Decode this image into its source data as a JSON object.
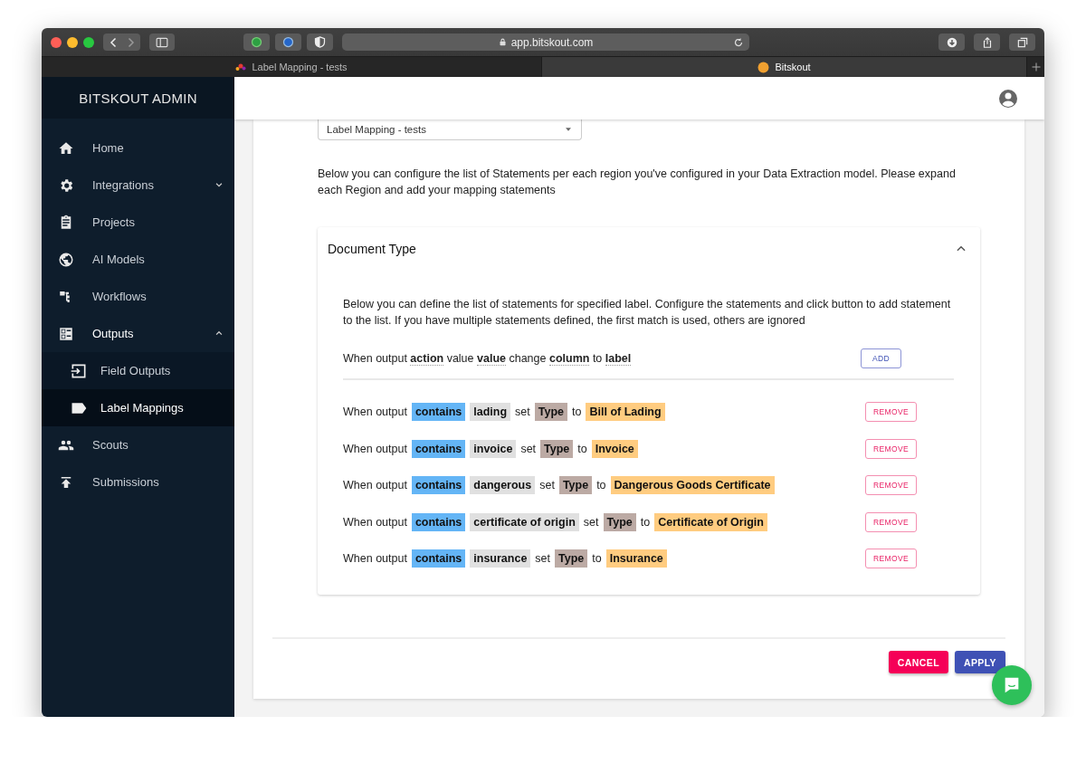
{
  "browser": {
    "address": "app.bitskout.com",
    "tabs": [
      {
        "title": "Label Mapping - tests",
        "selected": false
      },
      {
        "title": "Bitskout",
        "selected": true
      }
    ]
  },
  "sidebar": {
    "title": "BITSKOUT ADMIN",
    "items": [
      {
        "label": "Home",
        "selected": false
      },
      {
        "label": "Integrations",
        "selected": false,
        "expanded": false
      },
      {
        "label": "Projects",
        "selected": false
      },
      {
        "label": "AI Models",
        "selected": false
      },
      {
        "label": "Workflows",
        "selected": false
      },
      {
        "label": "Outputs",
        "selected": false,
        "expanded": true,
        "children": [
          {
            "label": "Field Outputs",
            "selected": false
          },
          {
            "label": "Label Mappings",
            "selected": true
          }
        ]
      },
      {
        "label": "Scouts",
        "selected": false
      },
      {
        "label": "Submissions",
        "selected": false
      }
    ]
  },
  "content": {
    "dropdown": {
      "value": "Label Mapping - tests"
    },
    "intro": "Below you can configure the list of Statements per each region you've configured in your Data Extraction model. Please expand each Region and add your mapping statements",
    "panel": {
      "title": "Document Type",
      "expanded": true,
      "description": "Below you can define the list of statements for specified label. Configure the statements and click button to add statement to the list. If you have multiple statements defined, the first match is used, others are ignored",
      "builder": {
        "sentence": "When output **action** value **value** change **column** to **label**",
        "button": "ADD"
      },
      "statements": [
        {
          "button": "REMOVE",
          "tokens": [
            {
              "kind": "text",
              "text": "When output"
            },
            {
              "kind": "action",
              "text": "contains"
            },
            {
              "kind": "value",
              "text": "lading"
            },
            {
              "kind": "text",
              "text": "set"
            },
            {
              "kind": "column",
              "text": "Type"
            },
            {
              "kind": "text",
              "text": "to"
            },
            {
              "kind": "label",
              "text": "Bill of Lading"
            }
          ]
        },
        {
          "button": "REMOVE",
          "tokens": [
            {
              "kind": "text",
              "text": "When output"
            },
            {
              "kind": "action",
              "text": "contains"
            },
            {
              "kind": "value",
              "text": "invoice"
            },
            {
              "kind": "text",
              "text": "set"
            },
            {
              "kind": "column",
              "text": "Type"
            },
            {
              "kind": "text",
              "text": "to"
            },
            {
              "kind": "label",
              "text": "Invoice"
            }
          ]
        },
        {
          "button": "REMOVE",
          "tokens": [
            {
              "kind": "text",
              "text": "When output"
            },
            {
              "kind": "action",
              "text": "contains"
            },
            {
              "kind": "value",
              "text": "dangerous"
            },
            {
              "kind": "text",
              "text": "set"
            },
            {
              "kind": "column",
              "text": "Type"
            },
            {
              "kind": "text",
              "text": "to"
            },
            {
              "kind": "label",
              "text": "Dangerous Goods Certificate"
            }
          ]
        },
        {
          "button": "REMOVE",
          "tokens": [
            {
              "kind": "text",
              "text": "When output"
            },
            {
              "kind": "action",
              "text": "contains"
            },
            {
              "kind": "value",
              "text": "certificate of origin"
            },
            {
              "kind": "text",
              "text": "set"
            },
            {
              "kind": "column",
              "text": "Type"
            },
            {
              "kind": "text",
              "text": "to"
            },
            {
              "kind": "label",
              "text": "Certificate of Origin"
            }
          ]
        },
        {
          "button": "REMOVE",
          "tokens": [
            {
              "kind": "text",
              "text": "When output"
            },
            {
              "kind": "action",
              "text": "contains"
            },
            {
              "kind": "value",
              "text": "insurance"
            },
            {
              "kind": "text",
              "text": "set"
            },
            {
              "kind": "column",
              "text": "Type"
            },
            {
              "kind": "text",
              "text": "to"
            },
            {
              "kind": "label",
              "text": "Insurance"
            }
          ]
        }
      ]
    },
    "actions": [
      {
        "kind": "cancel",
        "label": "CANCEL"
      },
      {
        "kind": "apply",
        "label": "APPLY"
      }
    ]
  }
}
